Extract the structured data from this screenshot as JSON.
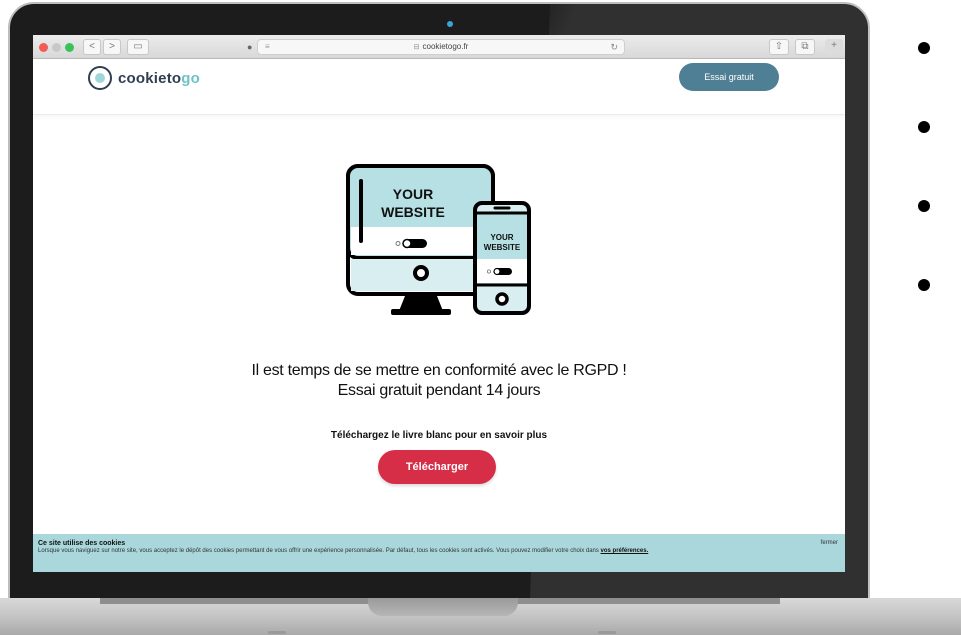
{
  "browser": {
    "url": "cookietogo.fr",
    "back_label": "<",
    "forward_label": ">",
    "sidebar_label": "▭",
    "privacy_label": "●",
    "reader_label": "≡",
    "reload_label": "↻",
    "share_label": "⇧",
    "tabs_label": "⧉",
    "new_tab_label": "+",
    "lock_label": "🔒"
  },
  "site": {
    "logo": {
      "main": "cookieto",
      "accent": "go"
    },
    "trial_button": "Essai gratuit",
    "illustration": {
      "monitor_text_line1": "YOUR",
      "monitor_text_line2": "WEBSITE",
      "phone_text_line1": "YOUR",
      "phone_text_line2": "WEBSITE"
    },
    "headline_line1": "Il est temps de se mettre en conformité avec le RGPD !",
    "headline_line2": "Essai gratuit pendant 14 jours",
    "subline": "Téléchargez le livre blanc pour en savoir plus",
    "download_button": "Télécharger"
  },
  "cookie_banner": {
    "title": "Ce site utilise des cookies",
    "text": "Lorsque vous naviguez sur notre site, vous acceptez le dépôt des cookies permettant de vous offrir une expérience personnalisée. Par défaut, tous les cookies sont activés. Vous pouvez modifier votre choix dans ",
    "link": "vos préférences.",
    "close": "fermer"
  },
  "colors": {
    "trial_button": "#4f7f94",
    "download_button": "#d62e47",
    "cookie_banner": "#a9d7dc",
    "screen_fill": "#b6e0e4"
  }
}
